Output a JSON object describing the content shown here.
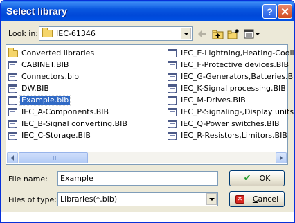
{
  "window": {
    "title": "Select library"
  },
  "toolbar": {
    "look_in_label": "Look in:",
    "look_in_value": "IEC-61346",
    "icons": [
      "back-arrow-icon",
      "up-folder-icon",
      "new-folder-icon",
      "view-menu-icon"
    ]
  },
  "files": {
    "left_column": [
      {
        "name": "Converted libraries",
        "type": "folder"
      },
      {
        "name": "CABINET.BIB",
        "type": "bib"
      },
      {
        "name": "Connectors.bib",
        "type": "bib"
      },
      {
        "name": "DW.BIB",
        "type": "bib"
      },
      {
        "name": "Example.bib",
        "type": "bib",
        "selected": true
      },
      {
        "name": "IEC_A-Components.BIB",
        "type": "bib"
      },
      {
        "name": "IEC_B-Signal converting.BIB",
        "type": "bib"
      },
      {
        "name": "IEC_C-Storage.BIB",
        "type": "bib"
      }
    ],
    "right_column": [
      {
        "name": "IEC_E-Lightning,Heating-Cooling",
        "type": "bib"
      },
      {
        "name": "IEC_F-Protective devices.BIB",
        "type": "bib"
      },
      {
        "name": "IEC_G-Generators,Batteries.BIB",
        "type": "bib"
      },
      {
        "name": "IEC_K-Signal processing.BIB",
        "type": "bib"
      },
      {
        "name": "IEC_M-Drives.BIB",
        "type": "bib"
      },
      {
        "name": "IEC_P-Signaling-,Display units.BI",
        "type": "bib"
      },
      {
        "name": "IEC_Q-Power switches.BIB",
        "type": "bib"
      },
      {
        "name": "IEC_R-Resistors,Limitors.BIB",
        "type": "bib"
      }
    ]
  },
  "form": {
    "file_name_label": "File name:",
    "file_name_value": "Example",
    "files_of_type_label": "Files of type:",
    "files_of_type_value": "Libraries(*.bib)"
  },
  "buttons": {
    "ok_label": "OK",
    "cancel_label": "Cancel"
  },
  "colors": {
    "title_bar": "#0a58e0",
    "selection": "#316ac5",
    "dialog_bg": "#ece9d8"
  }
}
